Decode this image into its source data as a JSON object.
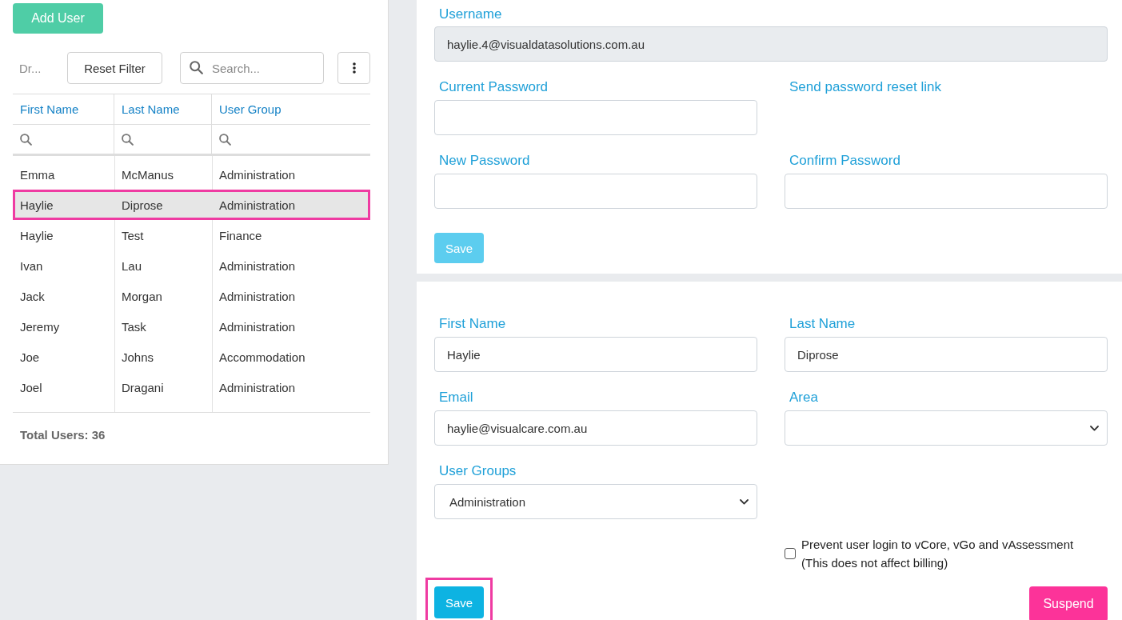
{
  "user_list": {
    "add_button": "Add User",
    "toolbar": {
      "dropdown": "Dr...",
      "reset_button": "Reset Filter",
      "search": {
        "placeholder": "Search..."
      }
    },
    "table": {
      "columns": [
        "First Name",
        "Last Name",
        "User Group"
      ],
      "rows": [
        {
          "cells": [
            "Emma",
            "McManus",
            "Administration"
          ],
          "selected": false,
          "highlighted": false
        },
        {
          "cells": [
            "Haylie",
            "Diprose",
            "Administration"
          ],
          "selected": true,
          "highlighted": true
        },
        {
          "cells": [
            "Haylie",
            "Test",
            "Finance"
          ],
          "selected": false,
          "highlighted": false
        },
        {
          "cells": [
            "Ivan",
            "Lau",
            "Administration"
          ],
          "selected": false,
          "highlighted": false
        },
        {
          "cells": [
            "Jack",
            "Morgan",
            "Administration"
          ],
          "selected": false,
          "highlighted": false
        },
        {
          "cells": [
            "Jeremy",
            "Task",
            "Administration"
          ],
          "selected": false,
          "highlighted": false
        },
        {
          "cells": [
            "Joe",
            "Johns",
            "Accommodation"
          ],
          "selected": false,
          "highlighted": false
        },
        {
          "cells": [
            "Joel",
            "Dragani",
            "Administration"
          ],
          "selected": false,
          "highlighted": false
        }
      ]
    },
    "total": "Total Users: 36"
  },
  "password_card": {
    "username": {
      "label": "Username",
      "value": "haylie.4@visualdatasolutions.com.au",
      "disabled": true
    },
    "current_password": {
      "label": "Current Password"
    },
    "reset_link": "Send password reset link",
    "new_password": {
      "label": "New Password"
    },
    "confirm_password": {
      "label": "Confirm Password"
    },
    "save_button": {
      "label": "Save",
      "disabled": true,
      "highlighted": false
    }
  },
  "details_card": {
    "fields": [
      {
        "kind": "text",
        "label": "First Name",
        "value": "Haylie"
      },
      {
        "kind": "text",
        "label": "Last Name",
        "value": "Diprose"
      },
      {
        "kind": "text",
        "label": "Email",
        "value": "haylie@visualcare.com.au"
      },
      {
        "kind": "select",
        "label": "Area"
      },
      {
        "kind": "select",
        "label": "User Groups",
        "value": "Administration"
      }
    ],
    "prevent_login": {
      "label": "Prevent user login to vCore, vGo and vAssessment",
      "note": "(This does not affect billing)",
      "checked": false
    },
    "save_button": {
      "label": "Save",
      "disabled": false,
      "highlighted": true
    },
    "suspend_button": "Suspend"
  }
}
